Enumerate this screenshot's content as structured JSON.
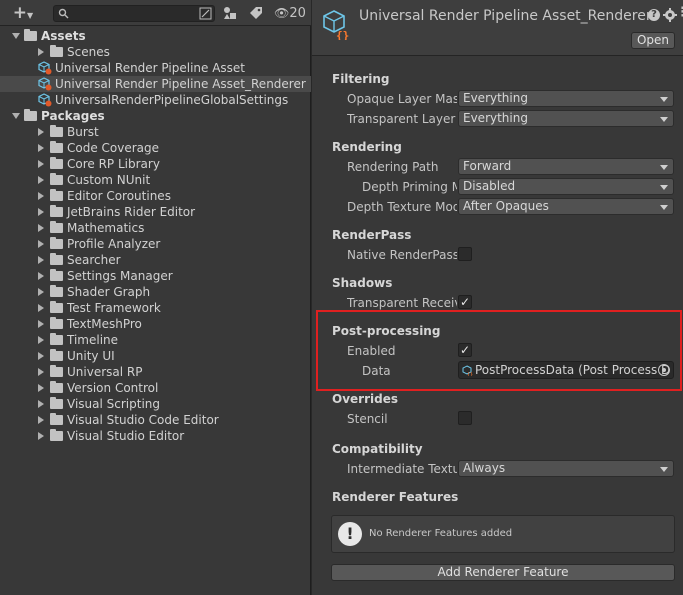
{
  "project": {
    "toolbar": {
      "create_label": "+",
      "hidden_count": "20",
      "search_placeholder": ""
    },
    "tree": [
      {
        "label": "Assets",
        "type": "root",
        "expanded": true,
        "depth": 0
      },
      {
        "label": "Scenes",
        "type": "folder",
        "expanded": false,
        "depth": 1
      },
      {
        "label": "Universal Render Pipeline Asset",
        "type": "asset",
        "depth": 1
      },
      {
        "label": "Universal Render Pipeline Asset_Renderer",
        "type": "asset",
        "depth": 1,
        "selected": true
      },
      {
        "label": "UniversalRenderPipelineGlobalSettings",
        "type": "asset",
        "depth": 1
      },
      {
        "label": "Packages",
        "type": "root",
        "expanded": true,
        "depth": 0
      },
      {
        "label": "Burst",
        "type": "folder",
        "depth": 1
      },
      {
        "label": "Code Coverage",
        "type": "folder",
        "depth": 1
      },
      {
        "label": "Core RP Library",
        "type": "folder",
        "depth": 1
      },
      {
        "label": "Custom NUnit",
        "type": "folder",
        "depth": 1
      },
      {
        "label": "Editor Coroutines",
        "type": "folder",
        "depth": 1
      },
      {
        "label": "JetBrains Rider Editor",
        "type": "folder",
        "depth": 1
      },
      {
        "label": "Mathematics",
        "type": "folder",
        "depth": 1
      },
      {
        "label": "Profile Analyzer",
        "type": "folder",
        "depth": 1
      },
      {
        "label": "Searcher",
        "type": "folder",
        "depth": 1
      },
      {
        "label": "Settings Manager",
        "type": "folder",
        "depth": 1
      },
      {
        "label": "Shader Graph",
        "type": "folder",
        "depth": 1
      },
      {
        "label": "Test Framework",
        "type": "folder",
        "depth": 1
      },
      {
        "label": "TextMeshPro",
        "type": "folder",
        "depth": 1
      },
      {
        "label": "Timeline",
        "type": "folder",
        "depth": 1
      },
      {
        "label": "Unity UI",
        "type": "folder",
        "depth": 1
      },
      {
        "label": "Universal RP",
        "type": "folder",
        "depth": 1
      },
      {
        "label": "Version Control",
        "type": "folder",
        "depth": 1
      },
      {
        "label": "Visual Scripting",
        "type": "folder",
        "depth": 1
      },
      {
        "label": "Visual Studio Code Editor",
        "type": "folder",
        "depth": 1
      },
      {
        "label": "Visual Studio Editor",
        "type": "folder",
        "depth": 1
      }
    ]
  },
  "inspector": {
    "title": "Universal Render Pipeline Asset_Renderer (U",
    "open_label": "Open",
    "sections": {
      "filtering": "Filtering",
      "rendering": "Rendering",
      "renderpass": "RenderPass",
      "shadows": "Shadows",
      "postprocessing": "Post-processing",
      "overrides": "Overrides",
      "compatibility": "Compatibility",
      "renderer_features": "Renderer Features"
    },
    "fields": {
      "opaque_layer_mask": {
        "label": "Opaque Layer Mask",
        "value": "Everything"
      },
      "transparent_layer_mask": {
        "label": "Transparent Layer Mask",
        "value": "Everything"
      },
      "rendering_path": {
        "label": "Rendering Path",
        "value": "Forward"
      },
      "depth_priming_mode": {
        "label": "Depth Priming Mode",
        "value": "Disabled"
      },
      "depth_texture_mode": {
        "label": "Depth Texture Mode",
        "value": "After Opaques"
      },
      "native_renderpass": {
        "label": "Native RenderPass",
        "checked": false
      },
      "transparent_receive_shadows": {
        "label": "Transparent Receive Shadows",
        "checked": true
      },
      "pp_enabled": {
        "label": "Enabled",
        "checked": true
      },
      "pp_data": {
        "label": "Data",
        "value": "PostProcessData (Post Process D"
      },
      "stencil": {
        "label": "Stencil",
        "checked": false
      },
      "intermediate_texture": {
        "label": "Intermediate Texture",
        "value": "Always"
      }
    },
    "features_message": "No Renderer Features added",
    "add_feature_label": "Add Renderer Feature",
    "highlight_color": "#e02020"
  }
}
